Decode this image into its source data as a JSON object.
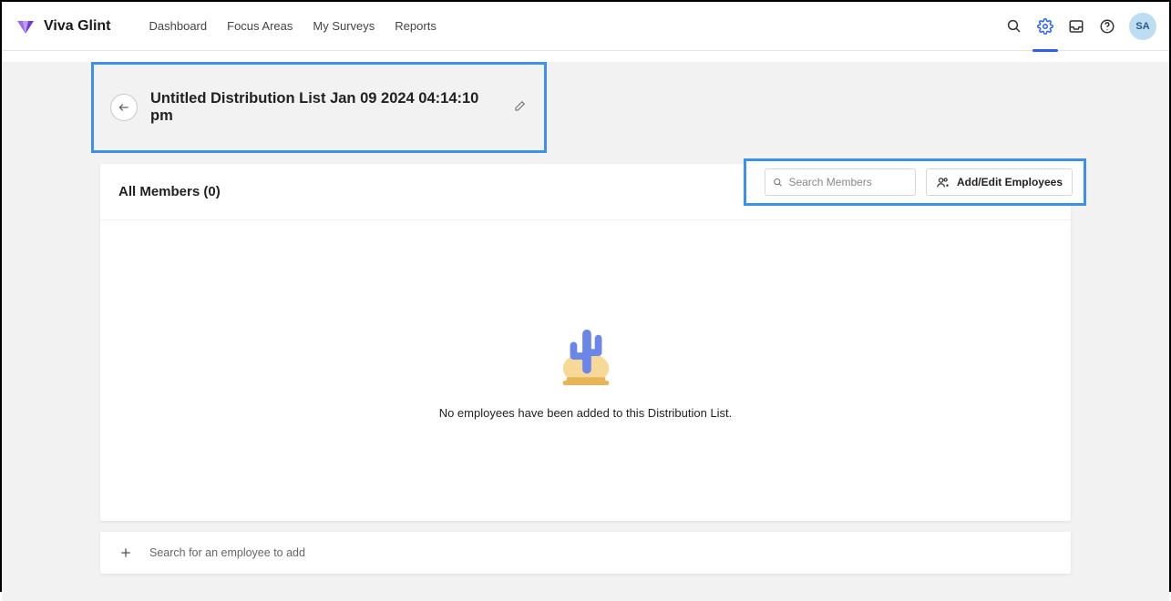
{
  "brand": {
    "name": "Viva Glint"
  },
  "nav": {
    "items": [
      "Dashboard",
      "Focus Areas",
      "My Surveys",
      "Reports"
    ]
  },
  "topbar": {
    "avatar_initials": "SA"
  },
  "page": {
    "title": "Untitled Distribution List Jan 09 2024 04:14:10 pm"
  },
  "members": {
    "heading": "All Members (0)",
    "search_placeholder": "Search Members",
    "addedit_label": "Add/Edit Employees",
    "empty_message": "No employees have been added to this Distribution List."
  },
  "footer": {
    "hint": "Search for an employee to add"
  }
}
